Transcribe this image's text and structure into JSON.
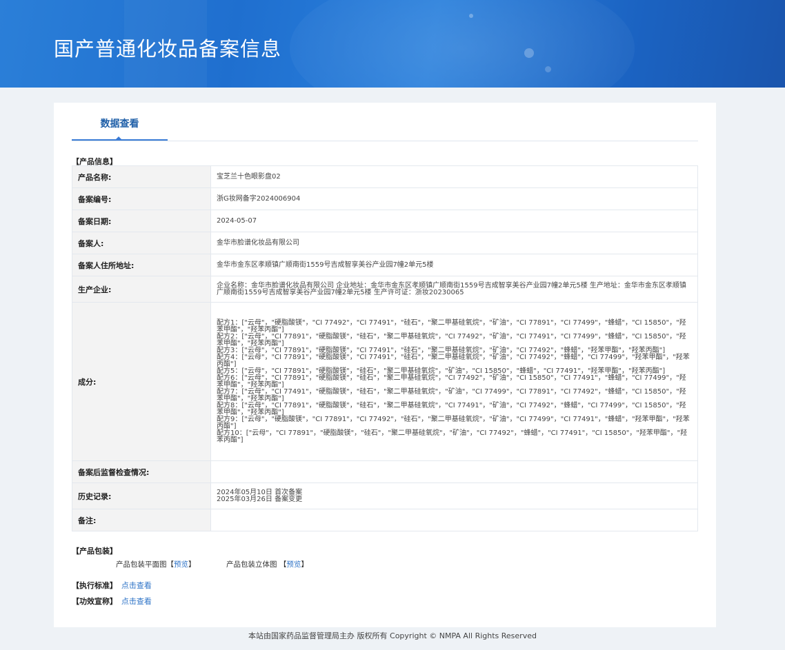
{
  "banner": {
    "title": "国产普通化妆品备案信息"
  },
  "tabs": [
    {
      "label": "数据查看"
    }
  ],
  "product_info": {
    "section_title": "【产品信息】",
    "rows": [
      {
        "label": "产品名称:",
        "value": "宝芝兰十色眼影盘02"
      },
      {
        "label": "备案编号:",
        "value": "浙G妆网备字2024006904"
      },
      {
        "label": "备案日期:",
        "value": "2024-05-07"
      },
      {
        "label": "备案人:",
        "value": "金华市脸谱化妆品有限公司"
      },
      {
        "label": "备案人住所地址:",
        "value": "金华市金东区孝顺镇广顺南街1559号吉成智享美谷产业园7幢2单元5楼"
      },
      {
        "label": "生产企业:",
        "value": "企业名称：金华市脸谱化妆品有限公司 企业地址：金华市金东区孝顺镇广顺南街1559号吉成智享美谷产业园7幢2单元5楼 生产地址：金华市金东区孝顺镇广顺南街1559号吉成智享美谷产业园7幢2单元5楼 生产许可证：浙妆20230065"
      },
      {
        "label": "成分:",
        "lines": [
          "配方1：[\"云母\"，\"硬脂酸镁\"，\"CI 77492\"，\"CI 77491\"，\"硅石\"，\"聚二甲基硅氧烷\"，\"矿油\"，\"CI 77891\"，\"CI 77499\"，\"蜂蜡\"，\"CI 15850\"，\"羟苯甲酯\"，\"羟苯丙酯\"]",
          "配方2：[\"云母\"，\"CI 77891\"，\"硬脂酸镁\"，\"硅石\"，\"聚二甲基硅氧烷\"，\"CI 77492\"，\"矿油\"，\"CI 77491\"，\"CI 77499\"，\"蜂蜡\"，\"CI 15850\"，\"羟苯甲酯\"，\"羟苯丙酯\"]",
          "配方3：[\"云母\"，\"CI 77891\"，\"硬脂酸镁\"，\"CI 77491\"，\"硅石\"，\"聚二甲基硅氧烷\"，\"矿油\"，\"CI 77492\"，\"蜂蜡\"，\"羟苯甲酯\"，\"羟苯丙酯\"]",
          "配方4：[\"云母\"，\"CI 77891\"，\"硬脂酸镁\"，\"CI 77491\"，\"硅石\"，\"聚二甲基硅氧烷\"，\"矿油\"，\"CI 77492\"，\"蜂蜡\"，\"CI 77499\"，\"羟苯甲酯\"，\"羟苯丙酯\"]",
          "配方5：[\"云母\"，\"CI 77891\"，\"硬脂酸镁\"，\"硅石\"，\"聚二甲基硅氧烷\"，\"矿油\"，\"CI 15850\"，\"蜂蜡\"，\"CI 77491\"，\"羟苯甲酯\"，\"羟苯丙酯\"]",
          "配方6：[\"云母\"，\"CI 77891\"，\"硬脂酸镁\"，\"硅石\"，\"聚二甲基硅氧烷\"，\"CI 77492\"，\"矿油\"，\"CI 15850\"，\"CI 77491\"，\"蜂蜡\"，\"CI 77499\"，\"羟苯甲酯\"，\"羟苯丙酯\"]",
          "配方7：[\"云母\"，\"CI 77491\"，\"硬脂酸镁\"，\"硅石\"，\"聚二甲基硅氧烷\"，\"矿油\"，\"CI 77499\"，\"CI 77891\"，\"CI 77492\"，\"蜂蜡\"，\"CI 15850\"，\"羟苯甲酯\"，\"羟苯丙酯\"]",
          "配方8：[\"云母\"，\"CI 77891\"，\"硬脂酸镁\"，\"硅石\"，\"聚二甲基硅氧烷\"，\"CI 77491\"，\"矿油\"，\"CI 77492\"，\"蜂蜡\"，\"CI 77499\"，\"CI 15850\"，\"羟苯甲酯\"，\"羟苯丙酯\"]",
          "配方9：[\"云母\"，\"硬脂酸镁\"，\"CI 77891\"，\"CI 77492\"，\"硅石\"，\"聚二甲基硅氧烷\"，\"矿油\"，\"CI 77499\"，\"CI 77491\"，\"蜂蜡\"，\"羟苯甲酯\"，\"羟苯丙酯\"]",
          "配方10：[\"云母\"，\"CI 77891\"，\"硬脂酸镁\"，\"硅石\"，\"聚二甲基硅氧烷\"，\"矿油\"，\"CI 77492\"，\"蜂蜡\"，\"CI 77491\"，\"CI 15850\"，\"羟苯甲酯\"，\"羟苯丙酯\"]"
        ]
      },
      {
        "label": "备案后监督检查情况:",
        "value": ""
      },
      {
        "label": "历史记录:",
        "lines": [
          "2024年05月10日 首次备案",
          "2025年03月26日 备案变更"
        ]
      },
      {
        "label": "备注:",
        "value": ""
      }
    ]
  },
  "packaging": {
    "section_title": "【产品包装】",
    "flat_label": "产品包装平面图",
    "flat_open": "【",
    "flat_link": "预览",
    "flat_close": "】",
    "solid_label": "产品包装立体图",
    "solid_open": "【",
    "solid_link": "预览",
    "solid_close": "】"
  },
  "standard": {
    "label": "【执行标准】",
    "link": "点击查看"
  },
  "efficacy": {
    "label": "【功效宣称】",
    "link": "点击查看"
  },
  "footer": {
    "text": "本站由国家药品监督管理局主办 版权所有 Copyright © NMPA All Rights Reserved"
  }
}
